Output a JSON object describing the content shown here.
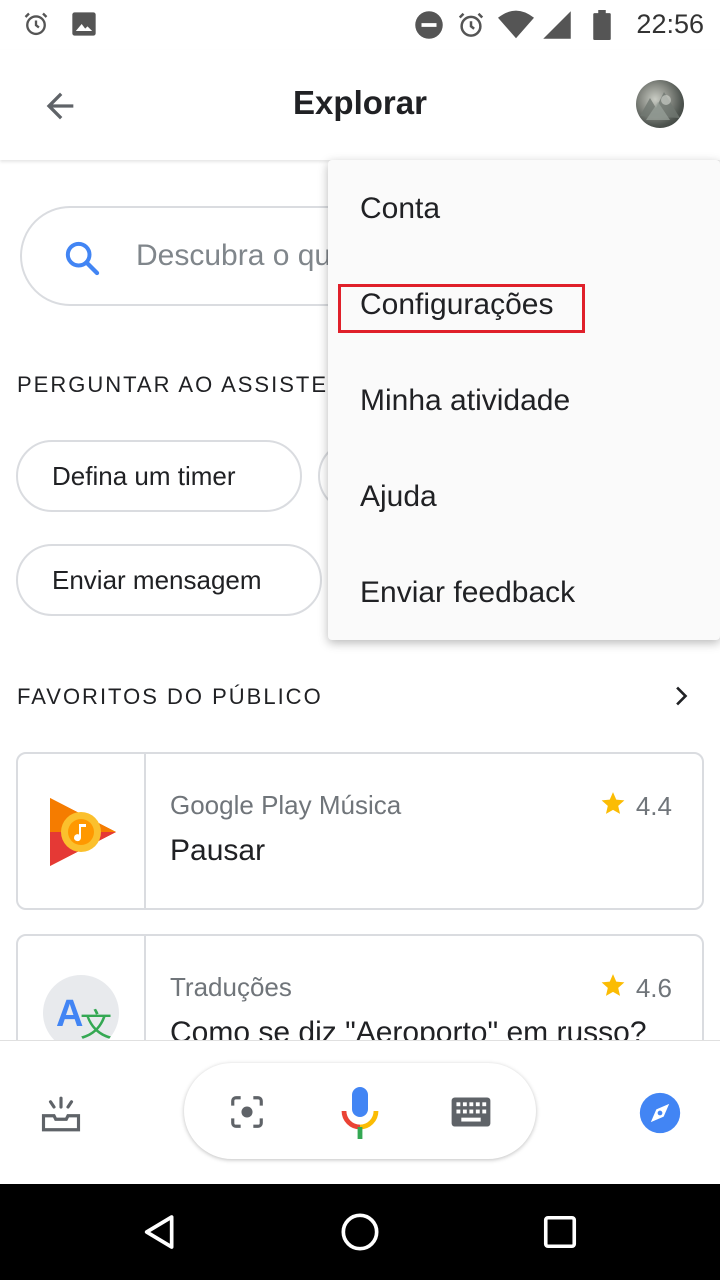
{
  "status_bar": {
    "time": "22:56",
    "left_icons": [
      "alarm-icon",
      "image-icon"
    ],
    "right_icons": [
      "do-not-disturb-icon",
      "alarm-icon",
      "wifi-icon",
      "signal-icon",
      "battery-icon"
    ]
  },
  "app_bar": {
    "title": "Explorar"
  },
  "search": {
    "placeholder": "Descubra o que"
  },
  "ask_section": {
    "title": "PERGUNTAR AO ASSISTE",
    "chips": [
      "Defina um timer",
      "Enviar mensagem"
    ]
  },
  "favorites_section": {
    "title": "FAVORITOS DO PÚBLICO",
    "cards": [
      {
        "app": "Google Play Música",
        "command": "Pausar",
        "rating": "4.4"
      },
      {
        "app": "Traduções",
        "command": "Como se diz \"Aeroporto\" em russo?",
        "rating": "4.6"
      }
    ]
  },
  "menu": {
    "items": [
      "Conta",
      "Configurações",
      "Minha atividade",
      "Ajuda",
      "Enviar feedback"
    ],
    "highlighted_item": "Configurações",
    "highlight_color": "#e0202a"
  },
  "colors": {
    "accent_blue": "#4285f4",
    "star_yellow": "#fbbc04"
  },
  "bottom_bar": {
    "icons": [
      "snapshot-icon",
      "lens-icon",
      "mic-icon",
      "keyboard-icon",
      "explore-compass-icon"
    ]
  },
  "nav_bar": {
    "icons": [
      "back-triangle-icon",
      "home-circle-icon",
      "recents-square-icon"
    ]
  }
}
